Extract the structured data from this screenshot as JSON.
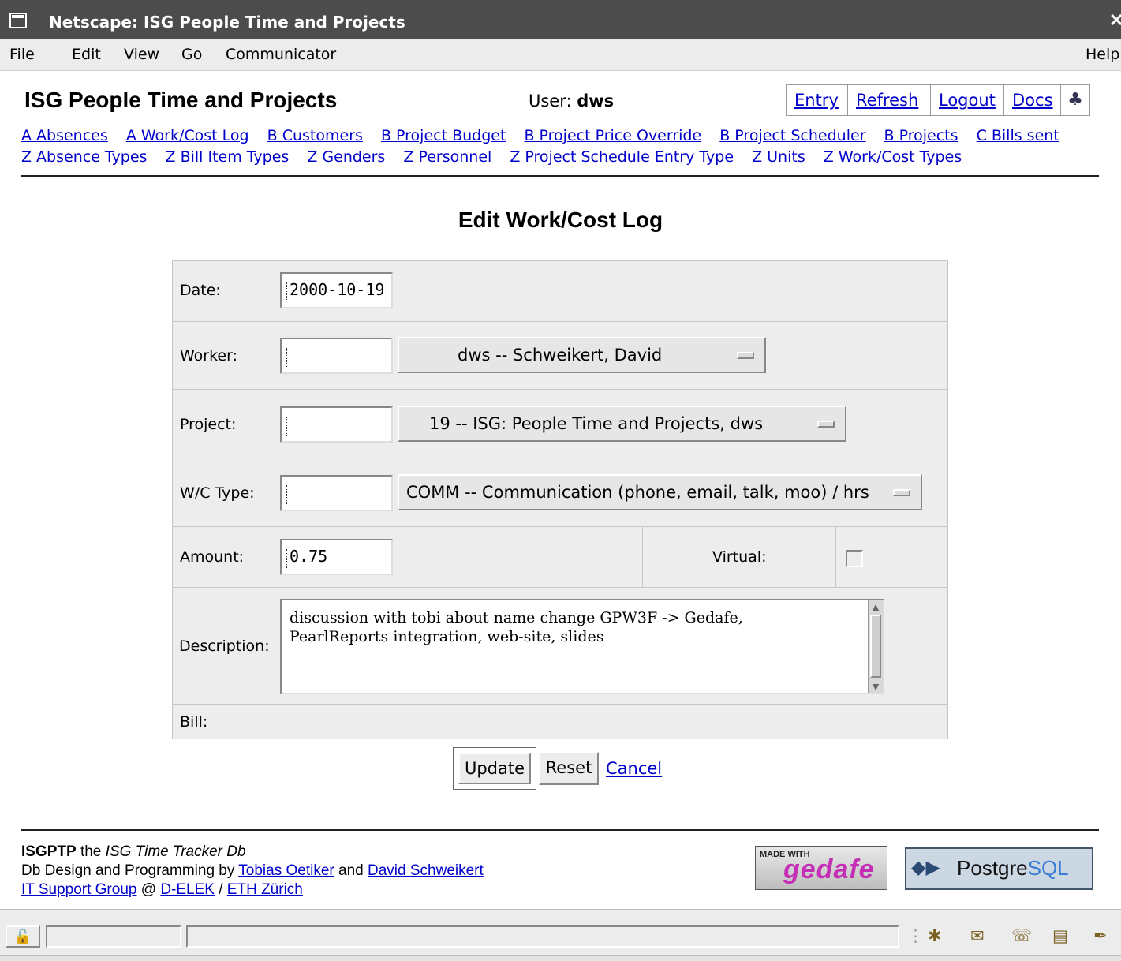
{
  "window": {
    "title": "Netscape: ISG People Time and Projects",
    "close_glyph": "✕"
  },
  "menubar": {
    "items": [
      "File",
      "Edit",
      "View",
      "Go",
      "Communicator"
    ],
    "help": "Help"
  },
  "header": {
    "app_title": "ISG People Time and Projects",
    "user_label": "User: ",
    "user_name": "dws",
    "buttons": [
      "Entry",
      "Refresh",
      "Logout",
      "Docs"
    ],
    "mozilla_icon": "mozilla-lizard-icon"
  },
  "nav": {
    "row1": [
      "A Absences",
      "A Work/Cost Log",
      "B Customers",
      "B Project Budget",
      "B Project Price Override",
      "B Project Scheduler",
      "B Projects",
      "C Bills sent"
    ],
    "row2": [
      "Z Absence Types",
      "Z Bill Item Types",
      "Z Genders",
      "Z Personnel",
      "Z Project Schedule Entry Type",
      "Z Units",
      "Z Work/Cost Types"
    ]
  },
  "form": {
    "title": "Edit Work/Cost Log",
    "date_label": "Date:",
    "date_value": "2000-10-19",
    "worker_label": "Worker:",
    "worker_select": "dws -- Schweikert, David",
    "project_label": "Project:",
    "project_select": "19 -- ISG: People Time and Projects, dws",
    "wc_label": "W/C Type:",
    "wc_select": "COMM -- Communication (phone, email, talk, moo) / hrs",
    "amount_label": "Amount:",
    "amount_value": "0.75",
    "virtual_label": "Virtual:",
    "virtual_checked": false,
    "description_label": "Description:",
    "description_value": "discussion with tobi about name change GPW3F -> Gedafe,\nPearlReports integration, web-site, slides",
    "bill_label": "Bill:",
    "update": "Update",
    "reset": "Reset",
    "cancel": "Cancel"
  },
  "footer": {
    "app_short": "ISGPTP",
    "the": " the ",
    "app_long": "ISG Time Tracker Db",
    "credits": "Db Design and Programming by ",
    "author1": "Tobias Oetiker",
    "and": " and ",
    "author2": "David Schweikert",
    "group": "IT Support Group",
    "at": " @ ",
    "dept": "D-ELEK",
    "slash": " / ",
    "uni": "ETH Zürich",
    "gedafe_made": "MADE WITH",
    "gedafe": "gedafe",
    "postgres": "Postgre",
    "sql": "SQL"
  },
  "status": {
    "lock": "lock-icon",
    "tray_icons": [
      "network-icon",
      "mail-icon",
      "chat-icon",
      "composer-icon",
      "edit-icon"
    ]
  }
}
